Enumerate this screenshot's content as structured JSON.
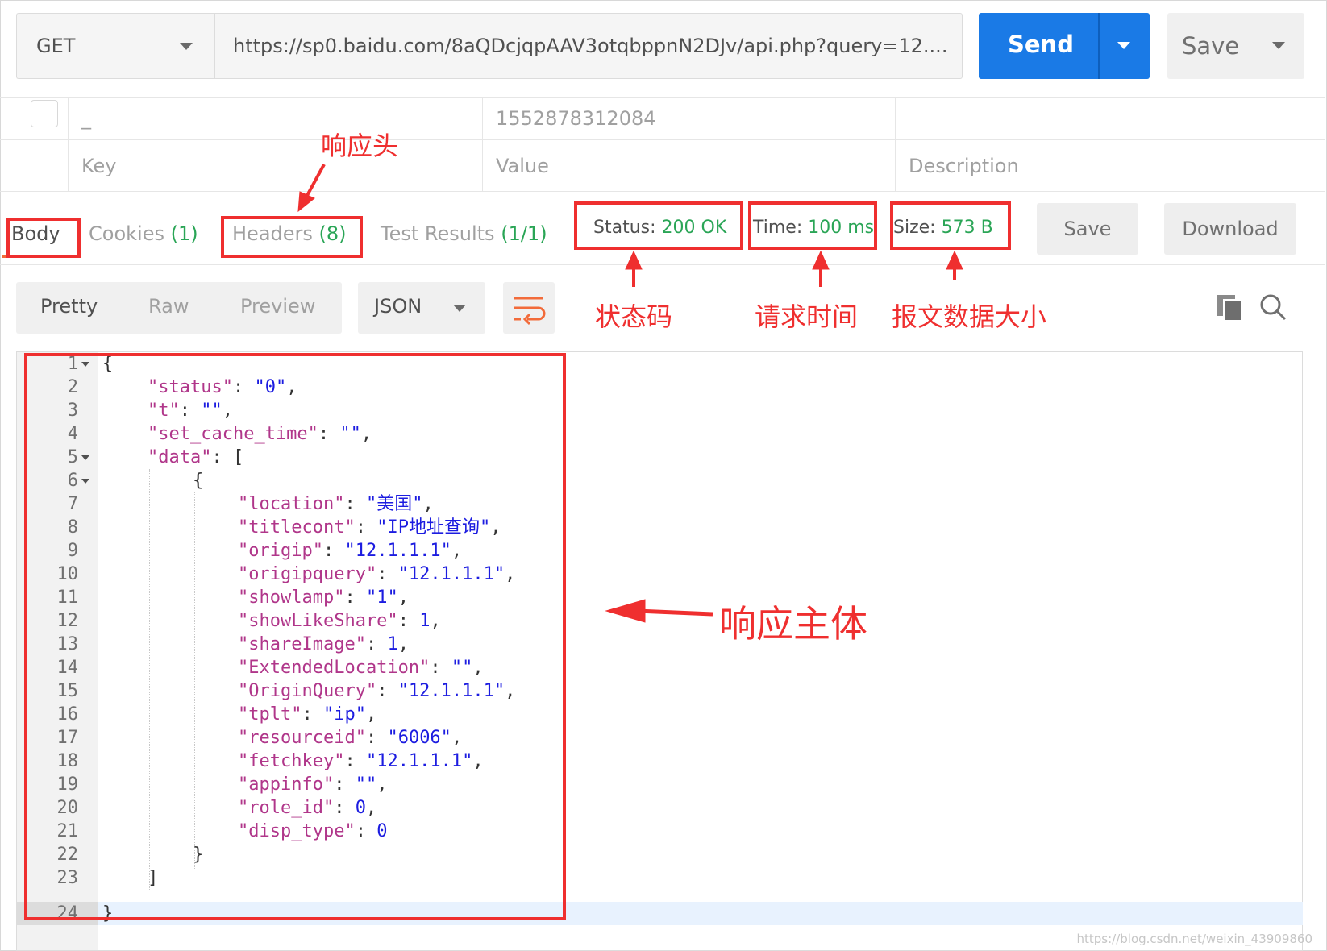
{
  "request": {
    "method": "GET",
    "url": "https://sp0.baidu.com/8aQDcjqpAAV3otqbppnN2DJv/api.php?query=12....",
    "send_label": "Send",
    "save_label": "Save"
  },
  "params": {
    "row1": {
      "key": "_",
      "value": "1552878312084",
      "description": ""
    },
    "placeholders": {
      "key": "Key",
      "value": "Value",
      "description": "Description"
    }
  },
  "response_tabs": [
    {
      "label": "Body",
      "count": ""
    },
    {
      "label": "Cookies",
      "count": "(1)"
    },
    {
      "label": "Headers",
      "count": "(8)"
    },
    {
      "label": "Test Results",
      "count": "(1/1)"
    }
  ],
  "metrics": {
    "status_label": "Status:",
    "status_value": "200 OK",
    "time_label": "Time:",
    "time_value": "100 ms",
    "size_label": "Size:",
    "size_value": "573 B"
  },
  "response_actions": {
    "save": "Save",
    "download": "Download"
  },
  "viewer": {
    "modes": [
      "Pretty",
      "Raw",
      "Preview"
    ],
    "format": "JSON"
  },
  "code_lines": [
    "1",
    "2",
    "3",
    "4",
    "5",
    "6",
    "7",
    "8",
    "9",
    "10",
    "11",
    "12",
    "13",
    "14",
    "15",
    "16",
    "17",
    "18",
    "19",
    "20",
    "21",
    "22",
    "23",
    "24"
  ],
  "code": {
    "l1": "{",
    "l2k": "\"status\"",
    "l2v": "\"0\"",
    "l3k": "\"t\"",
    "l3v": "\"\"",
    "l4k": "\"set_cache_time\"",
    "l4v": "\"\"",
    "l5k": "\"data\"",
    "l6": "{",
    "l7k": "\"location\"",
    "l7v": "\"美国\"",
    "l8k": "\"titlecont\"",
    "l8v": "\"IP地址查询\"",
    "l9k": "\"origip\"",
    "l9v": "\"12.1.1.1\"",
    "l10k": "\"origipquery\"",
    "l10v": "\"12.1.1.1\"",
    "l11k": "\"showlamp\"",
    "l11v": "\"1\"",
    "l12k": "\"showLikeShare\"",
    "l12v": "1",
    "l13k": "\"shareImage\"",
    "l13v": "1",
    "l14k": "\"ExtendedLocation\"",
    "l14v": "\"\"",
    "l15k": "\"OriginQuery\"",
    "l15v": "\"12.1.1.1\"",
    "l16k": "\"tplt\"",
    "l16v": "\"ip\"",
    "l17k": "\"resourceid\"",
    "l17v": "\"6006\"",
    "l18k": "\"fetchkey\"",
    "l18v": "\"12.1.1.1\"",
    "l19k": "\"appinfo\"",
    "l19v": "\"\"",
    "l20k": "\"role_id\"",
    "l20v": "0",
    "l21k": "\"disp_type\"",
    "l21v": "0",
    "l22": "}",
    "l23": "]",
    "l24": "}"
  },
  "annotations": {
    "headers": "响应头",
    "status": "状态码",
    "time": "请求时间",
    "size": "报文数据大小",
    "body": "响应主体"
  },
  "watermark": "https://blog.csdn.net/weixin_43909860",
  "colors": {
    "accent": "#1a7ae6",
    "count_green": "#2aa556",
    "annotation_red": "#ef2f2f",
    "tab_underline": "#f26b3a"
  }
}
